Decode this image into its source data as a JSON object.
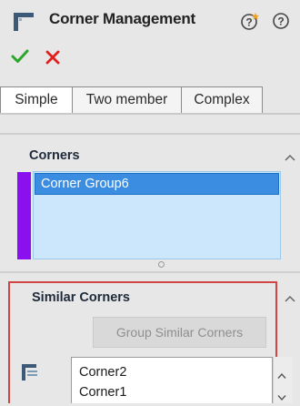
{
  "header": {
    "title": "Corner Management",
    "title_icon": "corner-management-icon",
    "help_icons": [
      "whats-new-help-icon",
      "help-icon"
    ]
  },
  "actions": {
    "ok_icon": "checkmark-icon",
    "cancel_icon": "close-icon",
    "ok_color": "#2aa62a",
    "cancel_color": "#e0201e"
  },
  "tabs": [
    {
      "label": "Simple",
      "selected": true
    },
    {
      "label": "Two member",
      "selected": false
    },
    {
      "label": "Complex",
      "selected": false
    }
  ],
  "corners": {
    "title": "Corners",
    "items": [
      {
        "label": "Corner Group6",
        "selected": true
      }
    ],
    "accent_color": "#8b10f0",
    "selection_color": "#3a8de0",
    "list_bg_color": "#cce7fb"
  },
  "similar_corners": {
    "title": "Similar Corners",
    "group_button_label": "Group Similar Corners",
    "group_button_enabled": false,
    "items": [
      {
        "label": "Corner2"
      },
      {
        "label": "Corner1"
      }
    ],
    "highlight_color": "#d24545"
  }
}
